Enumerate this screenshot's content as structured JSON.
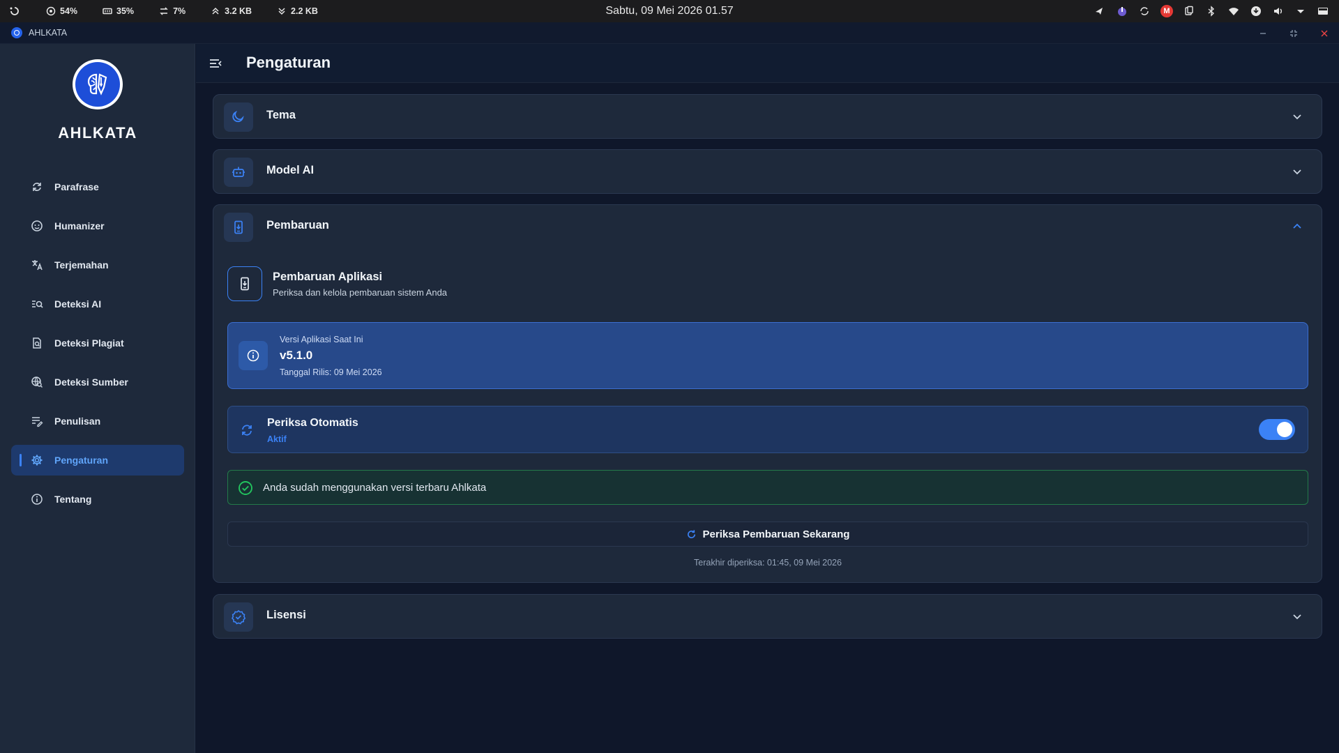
{
  "system_bar": {
    "stats": [
      {
        "icon": "cpu-icon",
        "value": "54%"
      },
      {
        "icon": "memory-icon",
        "value": "35%"
      },
      {
        "icon": "swap-icon",
        "value": "7%"
      },
      {
        "icon": "upload-icon",
        "value": "3.2 KB"
      },
      {
        "icon": "download-icon",
        "value": "2.2 KB"
      }
    ],
    "clock": "Sabtu, 09 Mei 2026 01.57",
    "tray_icons": [
      "notification-icon",
      "app-indicator-icon",
      "sync-icon",
      "mail-icon",
      "clipboard-icon",
      "bluetooth-icon",
      "wifi-icon",
      "update-icon",
      "volume-icon",
      "chevron-down-icon",
      "battery-icon"
    ],
    "mail_badge": "M"
  },
  "window": {
    "title": "AHLKATA"
  },
  "sidebar": {
    "brand": "AHLKATA",
    "items": [
      {
        "label": "Parafrase",
        "icon": "refresh-icon",
        "active": false
      },
      {
        "label": "Humanizer",
        "icon": "face-icon",
        "active": false
      },
      {
        "label": "Terjemahan",
        "icon": "translate-icon",
        "active": false
      },
      {
        "label": "Deteksi AI",
        "icon": "search-list-icon",
        "active": false
      },
      {
        "label": "Deteksi Plagiat",
        "icon": "document-search-icon",
        "active": false
      },
      {
        "label": "Deteksi Sumber",
        "icon": "globe-search-icon",
        "active": false
      },
      {
        "label": "Penulisan",
        "icon": "edit-list-icon",
        "active": false
      },
      {
        "label": "Pengaturan",
        "icon": "gear-icon",
        "active": true
      },
      {
        "label": "Tentang",
        "icon": "info-icon",
        "active": false
      }
    ]
  },
  "main": {
    "title": "Pengaturan",
    "sections": {
      "tema": {
        "title": "Tema",
        "icon": "moon-icon",
        "expanded": false
      },
      "model_ai": {
        "title": "Model AI",
        "icon": "robot-icon",
        "expanded": false
      },
      "pembaruan": {
        "title": "Pembaruan",
        "icon": "phone-download-icon",
        "expanded": true
      },
      "lisensi": {
        "title": "Lisensi",
        "icon": "badge-check-icon",
        "expanded": false
      }
    },
    "update": {
      "heading": "Pembaruan Aplikasi",
      "subheading": "Periksa dan kelola pembaruan sistem Anda",
      "version_label": "Versi Aplikasi Saat Ini",
      "version": "v5.1.0",
      "release_date": "Tanggal Rilis: 09 Mei 2026",
      "auto_check_label": "Periksa Otomatis",
      "auto_check_status": "Aktif",
      "auto_check_enabled": true,
      "up_to_date_message": "Anda sudah menggunakan versi terbaru Ahlkata",
      "check_button": "Periksa Pembaruan Sekarang",
      "last_checked": "Terakhir diperiksa: 01:45, 09 Mei 2026"
    }
  },
  "colors": {
    "accent": "#3b82f6",
    "sidebar_bg": "#1e293b",
    "main_bg": "#0f172a",
    "success": "#22c55e"
  }
}
